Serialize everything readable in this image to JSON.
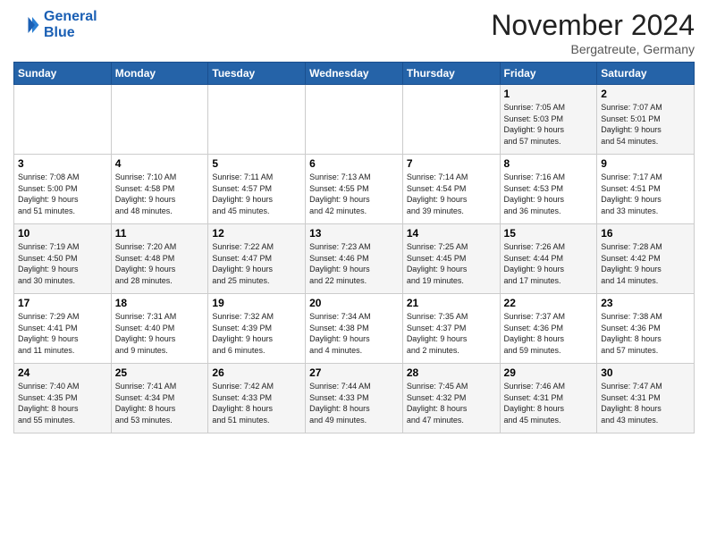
{
  "header": {
    "logo_line1": "General",
    "logo_line2": "Blue",
    "month_title": "November 2024",
    "location": "Bergatreute, Germany"
  },
  "weekdays": [
    "Sunday",
    "Monday",
    "Tuesday",
    "Wednesday",
    "Thursday",
    "Friday",
    "Saturday"
  ],
  "weeks": [
    [
      {
        "day": "",
        "info": ""
      },
      {
        "day": "",
        "info": ""
      },
      {
        "day": "",
        "info": ""
      },
      {
        "day": "",
        "info": ""
      },
      {
        "day": "",
        "info": ""
      },
      {
        "day": "1",
        "info": "Sunrise: 7:05 AM\nSunset: 5:03 PM\nDaylight: 9 hours\nand 57 minutes."
      },
      {
        "day": "2",
        "info": "Sunrise: 7:07 AM\nSunset: 5:01 PM\nDaylight: 9 hours\nand 54 minutes."
      }
    ],
    [
      {
        "day": "3",
        "info": "Sunrise: 7:08 AM\nSunset: 5:00 PM\nDaylight: 9 hours\nand 51 minutes."
      },
      {
        "day": "4",
        "info": "Sunrise: 7:10 AM\nSunset: 4:58 PM\nDaylight: 9 hours\nand 48 minutes."
      },
      {
        "day": "5",
        "info": "Sunrise: 7:11 AM\nSunset: 4:57 PM\nDaylight: 9 hours\nand 45 minutes."
      },
      {
        "day": "6",
        "info": "Sunrise: 7:13 AM\nSunset: 4:55 PM\nDaylight: 9 hours\nand 42 minutes."
      },
      {
        "day": "7",
        "info": "Sunrise: 7:14 AM\nSunset: 4:54 PM\nDaylight: 9 hours\nand 39 minutes."
      },
      {
        "day": "8",
        "info": "Sunrise: 7:16 AM\nSunset: 4:53 PM\nDaylight: 9 hours\nand 36 minutes."
      },
      {
        "day": "9",
        "info": "Sunrise: 7:17 AM\nSunset: 4:51 PM\nDaylight: 9 hours\nand 33 minutes."
      }
    ],
    [
      {
        "day": "10",
        "info": "Sunrise: 7:19 AM\nSunset: 4:50 PM\nDaylight: 9 hours\nand 30 minutes."
      },
      {
        "day": "11",
        "info": "Sunrise: 7:20 AM\nSunset: 4:48 PM\nDaylight: 9 hours\nand 28 minutes."
      },
      {
        "day": "12",
        "info": "Sunrise: 7:22 AM\nSunset: 4:47 PM\nDaylight: 9 hours\nand 25 minutes."
      },
      {
        "day": "13",
        "info": "Sunrise: 7:23 AM\nSunset: 4:46 PM\nDaylight: 9 hours\nand 22 minutes."
      },
      {
        "day": "14",
        "info": "Sunrise: 7:25 AM\nSunset: 4:45 PM\nDaylight: 9 hours\nand 19 minutes."
      },
      {
        "day": "15",
        "info": "Sunrise: 7:26 AM\nSunset: 4:44 PM\nDaylight: 9 hours\nand 17 minutes."
      },
      {
        "day": "16",
        "info": "Sunrise: 7:28 AM\nSunset: 4:42 PM\nDaylight: 9 hours\nand 14 minutes."
      }
    ],
    [
      {
        "day": "17",
        "info": "Sunrise: 7:29 AM\nSunset: 4:41 PM\nDaylight: 9 hours\nand 11 minutes."
      },
      {
        "day": "18",
        "info": "Sunrise: 7:31 AM\nSunset: 4:40 PM\nDaylight: 9 hours\nand 9 minutes."
      },
      {
        "day": "19",
        "info": "Sunrise: 7:32 AM\nSunset: 4:39 PM\nDaylight: 9 hours\nand 6 minutes."
      },
      {
        "day": "20",
        "info": "Sunrise: 7:34 AM\nSunset: 4:38 PM\nDaylight: 9 hours\nand 4 minutes."
      },
      {
        "day": "21",
        "info": "Sunrise: 7:35 AM\nSunset: 4:37 PM\nDaylight: 9 hours\nand 2 minutes."
      },
      {
        "day": "22",
        "info": "Sunrise: 7:37 AM\nSunset: 4:36 PM\nDaylight: 8 hours\nand 59 minutes."
      },
      {
        "day": "23",
        "info": "Sunrise: 7:38 AM\nSunset: 4:36 PM\nDaylight: 8 hours\nand 57 minutes."
      }
    ],
    [
      {
        "day": "24",
        "info": "Sunrise: 7:40 AM\nSunset: 4:35 PM\nDaylight: 8 hours\nand 55 minutes."
      },
      {
        "day": "25",
        "info": "Sunrise: 7:41 AM\nSunset: 4:34 PM\nDaylight: 8 hours\nand 53 minutes."
      },
      {
        "day": "26",
        "info": "Sunrise: 7:42 AM\nSunset: 4:33 PM\nDaylight: 8 hours\nand 51 minutes."
      },
      {
        "day": "27",
        "info": "Sunrise: 7:44 AM\nSunset: 4:33 PM\nDaylight: 8 hours\nand 49 minutes."
      },
      {
        "day": "28",
        "info": "Sunrise: 7:45 AM\nSunset: 4:32 PM\nDaylight: 8 hours\nand 47 minutes."
      },
      {
        "day": "29",
        "info": "Sunrise: 7:46 AM\nSunset: 4:31 PM\nDaylight: 8 hours\nand 45 minutes."
      },
      {
        "day": "30",
        "info": "Sunrise: 7:47 AM\nSunset: 4:31 PM\nDaylight: 8 hours\nand 43 minutes."
      }
    ]
  ]
}
